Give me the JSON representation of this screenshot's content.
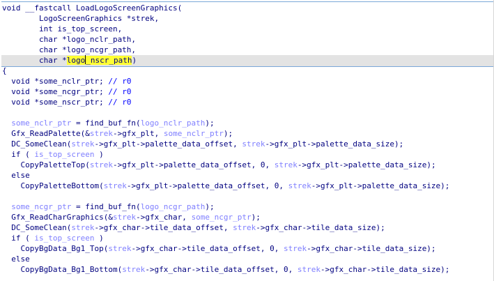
{
  "code_view": {
    "lines": [
      [
        {
          "t": "void __fastcall LoadLogoScreenGraphics("
        }
      ],
      [
        {
          "t": "        LogoScreenGraphics *strek,"
        }
      ],
      [
        {
          "t": "        int is_top_screen,"
        }
      ],
      [
        {
          "t": "        char *logo_nclr_path,"
        }
      ],
      [
        {
          "t": "        char *logo_ncgr_path,"
        }
      ],
      [
        {
          "t": "        char *"
        },
        {
          "t": "logo",
          "c": "sel"
        },
        {
          "t": "",
          "c": "caret"
        },
        {
          "t": "_nscr_path",
          "c": "sel"
        },
        {
          "t": ")"
        }
      ],
      [
        {
          "t": "{"
        }
      ],
      [
        {
          "t": "  void *some_nclr_ptr; "
        },
        {
          "t": "// r0",
          "c": "cmt"
        }
      ],
      [
        {
          "t": "  void *some_ncgr_ptr; "
        },
        {
          "t": "// r0",
          "c": "cmt"
        }
      ],
      [
        {
          "t": "  void *some_nscr_ptr; "
        },
        {
          "t": "// r0",
          "c": "cmt"
        }
      ],
      [
        {
          "t": ""
        }
      ],
      [
        {
          "t": "  "
        },
        {
          "t": "some_nclr_ptr",
          "c": "var"
        },
        {
          "t": " = find_buf_fn("
        },
        {
          "t": "logo_nclr_path",
          "c": "var"
        },
        {
          "t": ");"
        }
      ],
      [
        {
          "t": "  Gfx_ReadPalette(&"
        },
        {
          "t": "strek",
          "c": "var"
        },
        {
          "t": "->gfx_plt, "
        },
        {
          "t": "some_nclr_ptr",
          "c": "var"
        },
        {
          "t": ");"
        }
      ],
      [
        {
          "t": "  DC_SomeClean("
        },
        {
          "t": "strek",
          "c": "var"
        },
        {
          "t": "->gfx_plt->palette_data_offset, "
        },
        {
          "t": "strek",
          "c": "var"
        },
        {
          "t": "->gfx_plt->palette_data_size);"
        }
      ],
      [
        {
          "t": "  if ( "
        },
        {
          "t": "is_top_screen",
          "c": "var"
        },
        {
          "t": " )"
        }
      ],
      [
        {
          "t": "    CopyPaletteTop("
        },
        {
          "t": "strek",
          "c": "var"
        },
        {
          "t": "->gfx_plt->palette_data_offset, 0, "
        },
        {
          "t": "strek",
          "c": "var"
        },
        {
          "t": "->gfx_plt->palette_data_size);"
        }
      ],
      [
        {
          "t": "  else"
        }
      ],
      [
        {
          "t": "    CopyPaletteBottom("
        },
        {
          "t": "strek",
          "c": "var"
        },
        {
          "t": "->gfx_plt->palette_data_offset, 0, "
        },
        {
          "t": "strek",
          "c": "var"
        },
        {
          "t": "->gfx_plt->palette_data_size);"
        }
      ],
      [
        {
          "t": ""
        }
      ],
      [
        {
          "t": "  "
        },
        {
          "t": "some_ncgr_ptr",
          "c": "var"
        },
        {
          "t": " = find_buf_fn("
        },
        {
          "t": "logo_ncgr_path",
          "c": "var"
        },
        {
          "t": ");"
        }
      ],
      [
        {
          "t": "  Gfx_ReadCharGraphics(&"
        },
        {
          "t": "strek",
          "c": "var"
        },
        {
          "t": "->gfx_char, "
        },
        {
          "t": "some_ncgr_ptr",
          "c": "var"
        },
        {
          "t": ");"
        }
      ],
      [
        {
          "t": "  DC_SomeClean("
        },
        {
          "t": "strek",
          "c": "var"
        },
        {
          "t": "->gfx_char->tile_data_offset, "
        },
        {
          "t": "strek",
          "c": "var"
        },
        {
          "t": "->gfx_char->tile_data_size);"
        }
      ],
      [
        {
          "t": "  if ( "
        },
        {
          "t": "is_top_screen",
          "c": "var"
        },
        {
          "t": " )"
        }
      ],
      [
        {
          "t": "    CopyBgData_Bg1_Top("
        },
        {
          "t": "strek",
          "c": "var"
        },
        {
          "t": "->gfx_char->tile_data_offset, 0, "
        },
        {
          "t": "strek",
          "c": "var"
        },
        {
          "t": "->gfx_char->tile_data_size);"
        }
      ],
      [
        {
          "t": "  else"
        }
      ],
      [
        {
          "t": "    CopyBgData_Bg1_Bottom("
        },
        {
          "t": "strek",
          "c": "var"
        },
        {
          "t": "->gfx_char->tile_data_offset, 0, "
        },
        {
          "t": "strek",
          "c": "var"
        },
        {
          "t": "->gfx_char->tile_data_size);"
        }
      ]
    ]
  },
  "colors": {
    "background": "#ffffff",
    "text": "#00007f",
    "variable": "#7f7fff",
    "comment": "#0000ff",
    "selection": "#ffff33",
    "current_line": "#e3e3e3",
    "header_border": "#7aa7d8"
  }
}
